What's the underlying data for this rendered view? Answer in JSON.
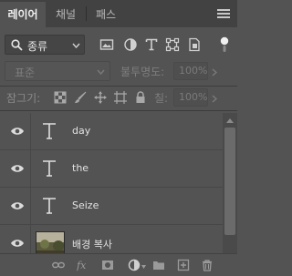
{
  "tabs": [
    {
      "label": "레이어",
      "active": true
    },
    {
      "label": "채널",
      "active": false
    },
    {
      "label": "패스",
      "active": false
    }
  ],
  "filter": {
    "kind_label": "종류",
    "icons": [
      "image-filter-icon",
      "adjustment-filter-icon",
      "type-filter-icon",
      "shape-filter-icon",
      "smart-object-filter-icon"
    ]
  },
  "blend": {
    "mode": "표준",
    "opacity_label": "불투명도:",
    "opacity_value": "100%"
  },
  "lock": {
    "label": "잠그기:",
    "fill_label": "칠:",
    "fill_value": "100%"
  },
  "layers": [
    {
      "name": "day",
      "type": "text",
      "visible": true
    },
    {
      "name": "the",
      "type": "text",
      "visible": true
    },
    {
      "name": "Seize",
      "type": "text",
      "visible": true
    },
    {
      "name": "배경 복사",
      "type": "image",
      "visible": true
    }
  ],
  "colors": {
    "panel_bg": "#535353",
    "tabbar_bg": "#424242",
    "text": "#e2e2e2",
    "dim_text": "#7e7e7e"
  }
}
